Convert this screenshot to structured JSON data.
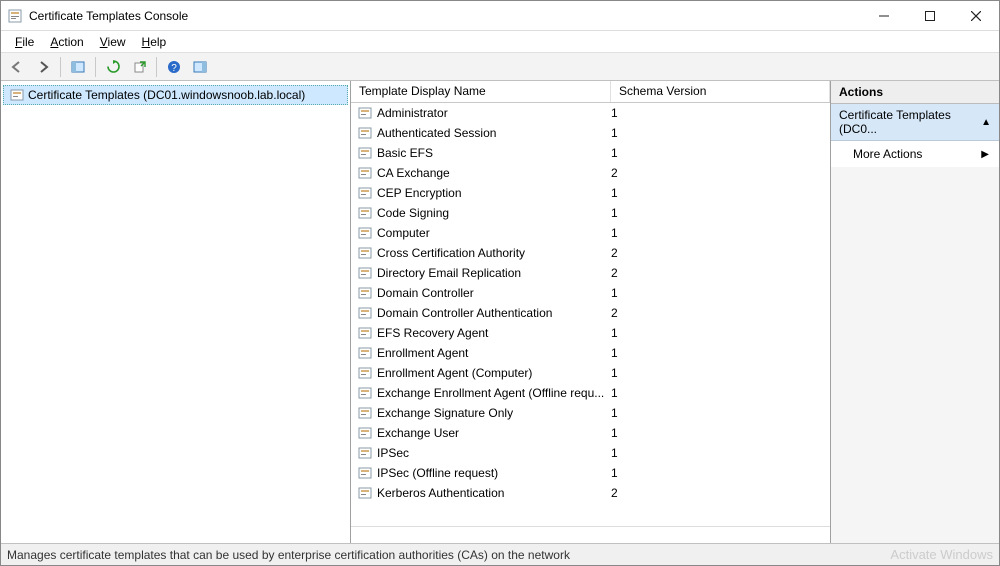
{
  "window": {
    "title": "Certificate Templates Console"
  },
  "menu": {
    "file": "File",
    "action": "Action",
    "view": "View",
    "help": "Help"
  },
  "tree": {
    "root": "Certificate Templates (DC01.windowsnoob.lab.local)"
  },
  "columns": {
    "name": "Template Display Name",
    "schema": "Schema Version"
  },
  "templates": [
    {
      "name": "Administrator",
      "schema": "1"
    },
    {
      "name": "Authenticated Session",
      "schema": "1"
    },
    {
      "name": "Basic EFS",
      "schema": "1"
    },
    {
      "name": "CA Exchange",
      "schema": "2"
    },
    {
      "name": "CEP Encryption",
      "schema": "1"
    },
    {
      "name": "Code Signing",
      "schema": "1"
    },
    {
      "name": "Computer",
      "schema": "1"
    },
    {
      "name": "Cross Certification Authority",
      "schema": "2"
    },
    {
      "name": "Directory Email Replication",
      "schema": "2"
    },
    {
      "name": "Domain Controller",
      "schema": "1"
    },
    {
      "name": "Domain Controller Authentication",
      "schema": "2"
    },
    {
      "name": "EFS Recovery Agent",
      "schema": "1"
    },
    {
      "name": "Enrollment Agent",
      "schema": "1"
    },
    {
      "name": "Enrollment Agent (Computer)",
      "schema": "1"
    },
    {
      "name": "Exchange Enrollment Agent (Offline requ...",
      "schema": "1"
    },
    {
      "name": "Exchange Signature Only",
      "schema": "1"
    },
    {
      "name": "Exchange User",
      "schema": "1"
    },
    {
      "name": "IPSec",
      "schema": "1"
    },
    {
      "name": "IPSec (Offline request)",
      "schema": "1"
    },
    {
      "name": "Kerberos Authentication",
      "schema": "2"
    }
  ],
  "actions": {
    "header": "Actions",
    "group": "Certificate Templates (DC0...",
    "more": "More Actions"
  },
  "status": {
    "text": "Manages certificate templates that can be used by enterprise certification authorities (CAs) on the network",
    "watermark": "Activate Windows"
  }
}
